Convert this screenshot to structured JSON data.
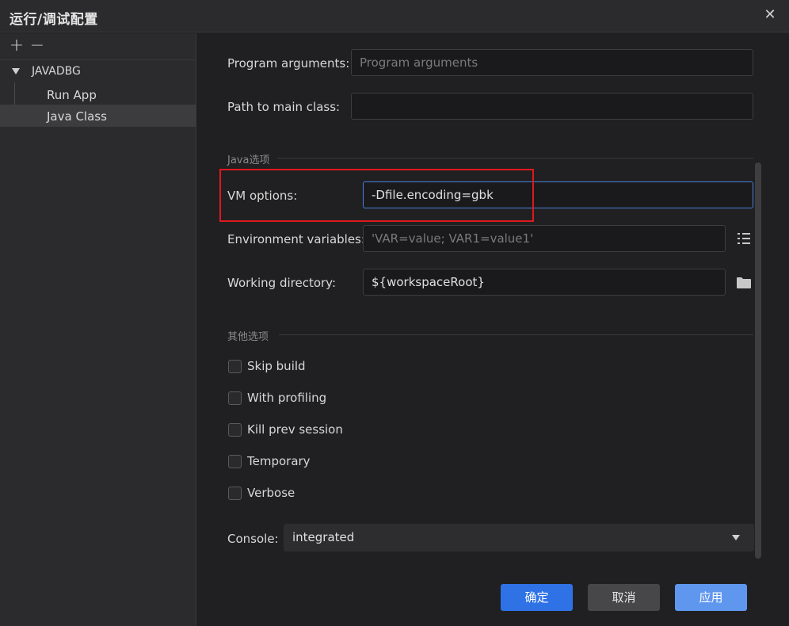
{
  "window": {
    "title": "运行/调试配置",
    "close_icon": "✕"
  },
  "sidebar": {
    "add_icon": "+",
    "remove_icon": "−",
    "root_label": "JAVADBG",
    "items": [
      {
        "label": "Run App"
      },
      {
        "label": "Java Class"
      }
    ]
  },
  "form": {
    "program_arguments": {
      "label": "Program arguments:",
      "value": "",
      "placeholder": "Program arguments"
    },
    "main_class": {
      "label": "Path to main class:",
      "value": ""
    },
    "java_section": "Java选项",
    "vm_options": {
      "label": "VM options:",
      "value": "-Dfile.encoding=gbk"
    },
    "env_vars": {
      "label": "Environment variables:",
      "value": "",
      "placeholder": "'VAR=value; VAR1=value1'"
    },
    "working_dir": {
      "label": "Working directory:",
      "value": "${workspaceRoot}"
    },
    "other_section": "其他选项",
    "checkboxes": [
      {
        "label": "Skip build",
        "checked": false
      },
      {
        "label": "With profiling",
        "checked": false
      },
      {
        "label": "Kill prev session",
        "checked": false
      },
      {
        "label": "Temporary",
        "checked": false
      },
      {
        "label": "Verbose",
        "checked": false
      }
    ],
    "console": {
      "label": "Console:",
      "value": "integrated"
    }
  },
  "buttons": {
    "ok": "确定",
    "cancel": "取消",
    "apply": "应用"
  },
  "colors": {
    "highlight": "#e0181e",
    "primary": "#2f72e6",
    "focus": "#4a7fd8"
  }
}
